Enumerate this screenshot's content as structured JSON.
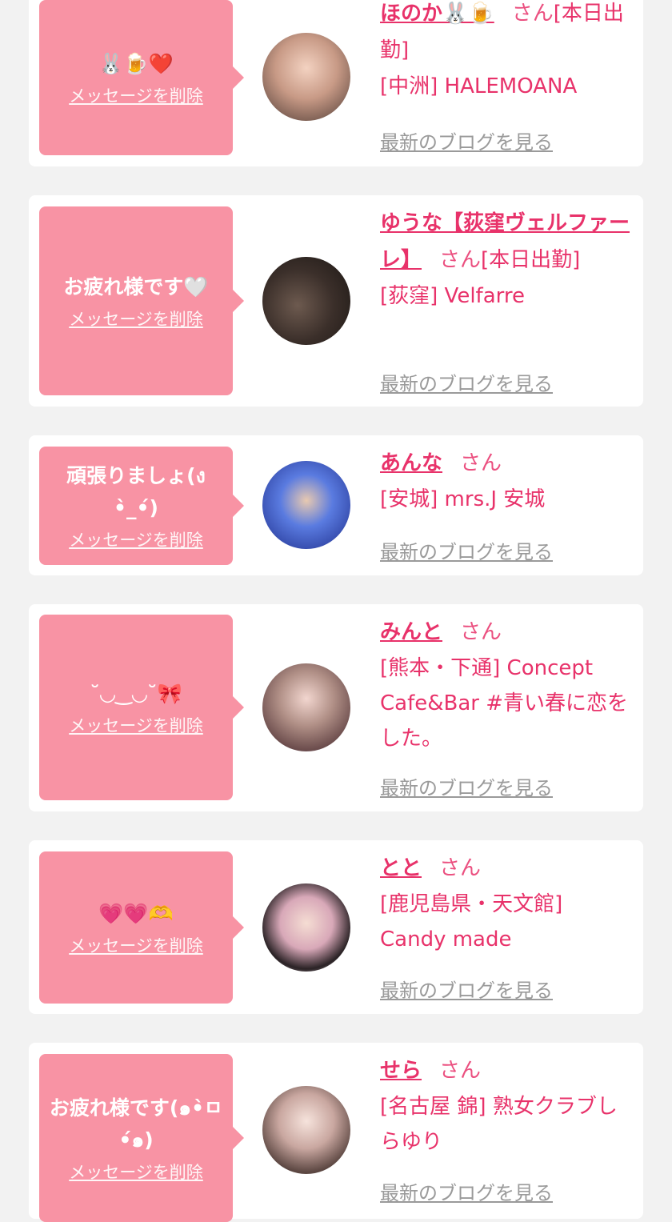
{
  "delete_label": "メッセージを削除",
  "blog_label": "最新のブログを見る",
  "san": "さん",
  "cards": [
    {
      "message": "🐰🍺❤️",
      "name": "ほのか🐰🍺",
      "status": "[本日出勤]",
      "shop": "[中洲] HALEMOANA",
      "avatar_icon": "profile-photo"
    },
    {
      "message": "お疲れ様です🤍",
      "name": "ゆうな【荻窪ヴェルファーレ】",
      "status": "[本日出勤]",
      "shop": "[荻窪] Velfarre",
      "avatar_icon": "profile-photo"
    },
    {
      "message": "頑張りましょ(ง\n•̀_•́)",
      "name": "あんな",
      "status": "",
      "shop": "[安城] mrs.J 安城",
      "avatar_icon": "profile-photo"
    },
    {
      "message": "˘◡‿◡˘🎀",
      "name": "みんと",
      "status": "",
      "shop": "[熊本・下通] Concept Cafe&Bar #青い春に恋をした。",
      "avatar_icon": "profile-photo"
    },
    {
      "message": "💗💗🫶",
      "name": "とと",
      "status": "",
      "shop": "[鹿児島県・天文館] Candy made",
      "avatar_icon": "profile-photo"
    },
    {
      "message": "お疲れ様です(๑•̀ㅁ\n•́๑)",
      "name": "せら",
      "status": "",
      "shop": "[名古屋 錦] 熟女クラブしらゆり",
      "avatar_icon": "profile-photo"
    }
  ],
  "colors": {
    "bubble": "#f893a4",
    "accent": "#e8326a",
    "muted": "#9a9a9a",
    "background": "#f2f2f2"
  }
}
